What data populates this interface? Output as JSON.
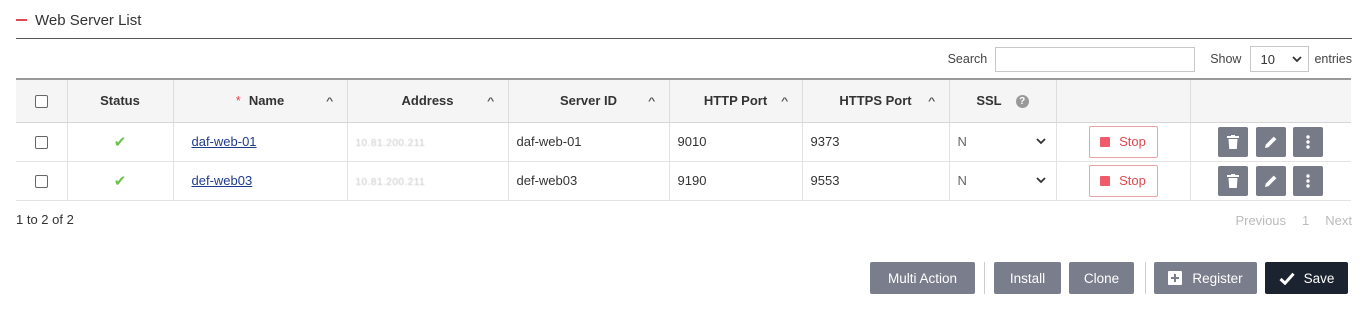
{
  "section": {
    "title": "Web Server List"
  },
  "toolbar": {
    "search_label": "Search",
    "search_value": "",
    "show_label": "Show",
    "show_value": "10",
    "entries_label": "entries"
  },
  "table": {
    "headers": {
      "status": "Status",
      "name": "Name",
      "address": "Address",
      "server_id": "Server ID",
      "http_port": "HTTP Port",
      "https_port": "HTTPS Port",
      "ssl": "SSL"
    },
    "rows": [
      {
        "name": "daf-web-01",
        "address": "10.81.200.211",
        "server_id": "daf-web-01",
        "http_port": "9010",
        "https_port": "9373",
        "ssl": "N",
        "action": "Stop"
      },
      {
        "name": "def-web03",
        "address": "10.81.200.211",
        "server_id": "def-web03",
        "http_port": "9190",
        "https_port": "9553",
        "ssl": "N",
        "action": "Stop"
      }
    ]
  },
  "pagination": {
    "info": "1 to 2 of 2",
    "previous": "Previous",
    "page": "1",
    "next": "Next"
  },
  "actions": {
    "multi_action": "Multi Action",
    "install": "Install",
    "clone": "Clone",
    "register": "Register",
    "save": "Save"
  },
  "colors": {
    "accent": "#e2474f",
    "button": "#7a7d8b",
    "save": "#1b2330",
    "status_ok": "#6cc24a"
  }
}
